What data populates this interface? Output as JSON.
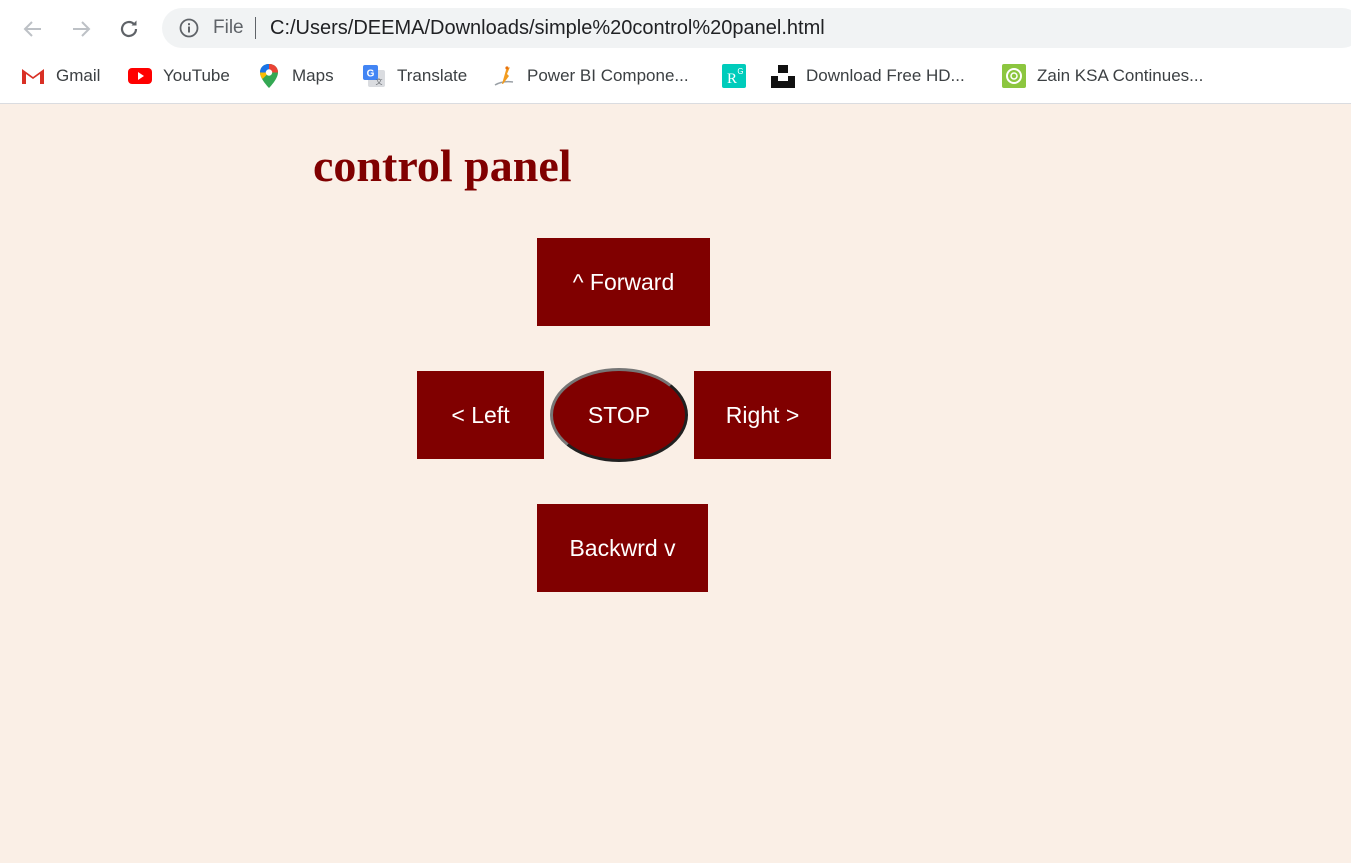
{
  "browser": {
    "omnibox": {
      "file_label": "File",
      "url": "C:/Users/DEEMA/Downloads/simple%20control%20panel.html"
    },
    "bookmarks": [
      {
        "label": "Gmail",
        "icon": "gmail-icon"
      },
      {
        "label": "YouTube",
        "icon": "youtube-icon"
      },
      {
        "label": "Maps",
        "icon": "maps-icon"
      },
      {
        "label": "Translate",
        "icon": "translate-icon"
      },
      {
        "label": "Power BI Compone...",
        "icon": "power-bi-icon"
      },
      {
        "label": "",
        "icon": "rg-icon"
      },
      {
        "label": "Download Free HD...",
        "icon": "unsplash-icon"
      },
      {
        "label": "Zain KSA Continues...",
        "icon": "zain-icon"
      }
    ]
  },
  "page": {
    "title": "control panel",
    "buttons": {
      "forward": "^ Forward",
      "left": "< Left",
      "stop": "STOP",
      "right": "Right >",
      "backward": "Backwrd v"
    }
  },
  "colors": {
    "page_background": "#faefe6",
    "button_background": "#800000",
    "title_color": "#800000",
    "button_text": "#ffffff"
  }
}
